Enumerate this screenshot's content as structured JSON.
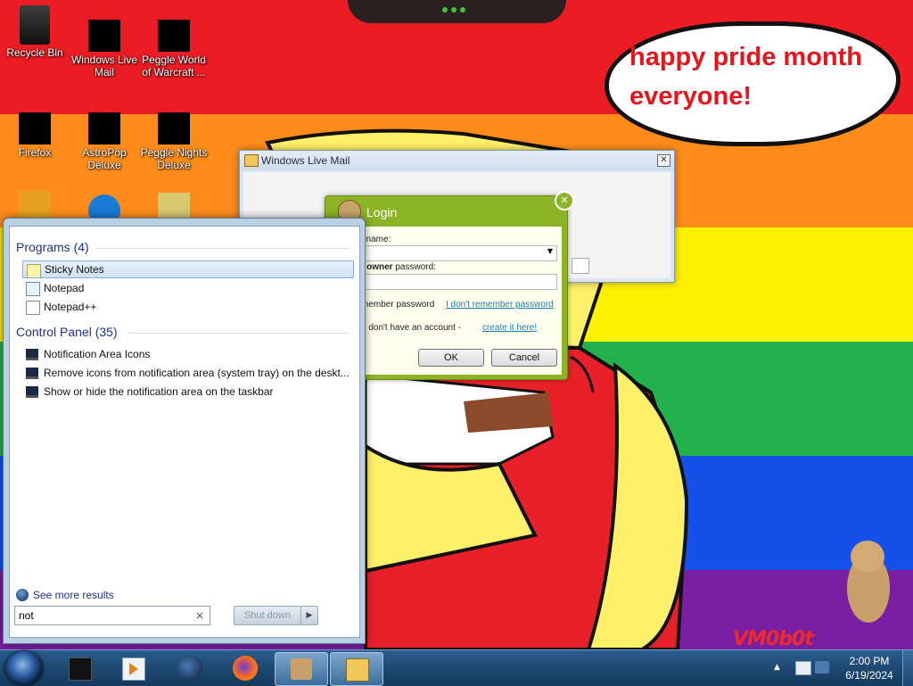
{
  "desktop": {
    "speech_bubble": "happy pride month everyone!",
    "watermark": "VM0b0t",
    "icons": [
      {
        "label": "Recycle Bin"
      },
      {
        "label": "Windows Live Mail"
      },
      {
        "label": "Peggle World of Warcraft ..."
      },
      {
        "label": "Firefox"
      },
      {
        "label": "AstroPop Deluxe"
      },
      {
        "label": "Peggle Nights Deluxe"
      }
    ],
    "colors": {
      "red": "#ec1c24",
      "orange": "#ff8c1a",
      "yellow": "#fff200",
      "green": "#22b14c",
      "blue": "#1550e8",
      "purple": "#7a1fa2"
    }
  },
  "wlm_window": {
    "title": "Windows Live Mail",
    "close_icon": "close-icon"
  },
  "login": {
    "title": "Login",
    "account_label": "t name:",
    "password_label_bold": "t owner",
    "password_label_rest": " password:",
    "remember_label": "member password",
    "forgot_link": "I don't remember password",
    "no_account_text": "u don't have an account - ",
    "create_link": "create it here!",
    "ok_label": "OK",
    "cancel_label": "Cancel",
    "accent": "#8db327"
  },
  "start_menu": {
    "programs_header": "Programs (4)",
    "programs": [
      {
        "label": "Sticky Notes",
        "icon": "sticky-notes-icon",
        "selected": true
      },
      {
        "label": "Notepad",
        "icon": "notepad-icon"
      },
      {
        "label": "Notepad++",
        "icon": "notepad-plus-plus-icon"
      }
    ],
    "control_panel_header": "Control Panel (35)",
    "control_panel": [
      {
        "label": "Notification Area Icons",
        "icon": "control-panel-icon"
      },
      {
        "label": "Remove icons from notification area (system tray) on the deskt...",
        "icon": "control-panel-icon"
      },
      {
        "label": "Show or hide the notification area on the taskbar",
        "icon": "control-panel-icon"
      }
    ],
    "see_more": "See more results",
    "search_value": "not",
    "search_clear": "×",
    "shutdown_label": "Shut down",
    "shutdown_arrow": "▶"
  },
  "taskbar": {
    "clock_time": "2:00 PM",
    "clock_date": "6/19/2024",
    "tray_arrow": "▲",
    "pinned": [
      {
        "name": "taskbar-app-1",
        "icon": "black-box-icon"
      },
      {
        "name": "taskbar-media-player",
        "icon": "media-player-icon"
      },
      {
        "name": "taskbar-app-globe",
        "icon": "globe-icon"
      },
      {
        "name": "taskbar-firefox",
        "icon": "firefox-icon"
      },
      {
        "name": "taskbar-login-app",
        "icon": "hamster-icon",
        "active": true
      },
      {
        "name": "taskbar-windows-live-mail",
        "icon": "mail-icon",
        "active": true
      }
    ]
  }
}
